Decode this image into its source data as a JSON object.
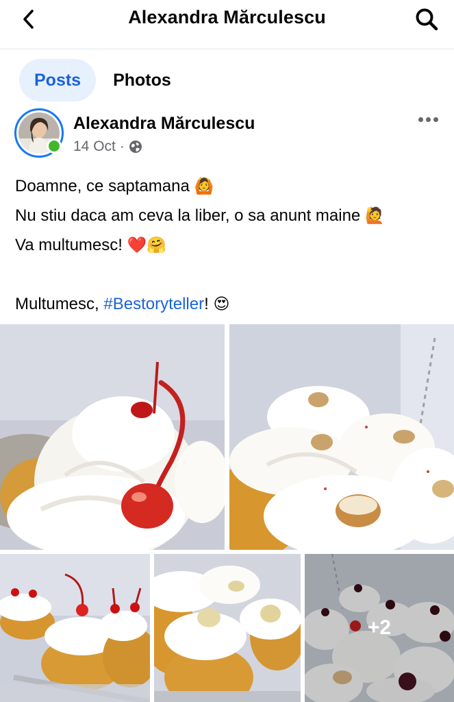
{
  "header": {
    "title": "Alexandra Mărculescu"
  },
  "tabs": [
    {
      "label": "Posts",
      "active": true
    },
    {
      "label": "Photos",
      "active": false
    }
  ],
  "post": {
    "author": "Alexandra Mărculescu",
    "date": "14 Oct",
    "date_separator": "·",
    "audience_icon": "globe-icon",
    "lines": {
      "line1_text": "Doamne, ce saptamana ",
      "line1_emoji": "🙆",
      "line2_text": "Nu stiu daca am ceva la liber, o sa anunt maine ",
      "line2_emoji": "🙋",
      "line3_text": "Va multumesc! ",
      "line3_emoji": "❤️🤗",
      "line5_prefix": "Multumesc, ",
      "line5_hashtag": "#Bestoryteller",
      "line5_suffix": "! ",
      "line5_emoji": "😍"
    },
    "photos_more_count": "+2"
  },
  "colors": {
    "accent": "#1a63d8",
    "tab_active_bg": "#e7f0fd",
    "online": "#42b72a"
  }
}
